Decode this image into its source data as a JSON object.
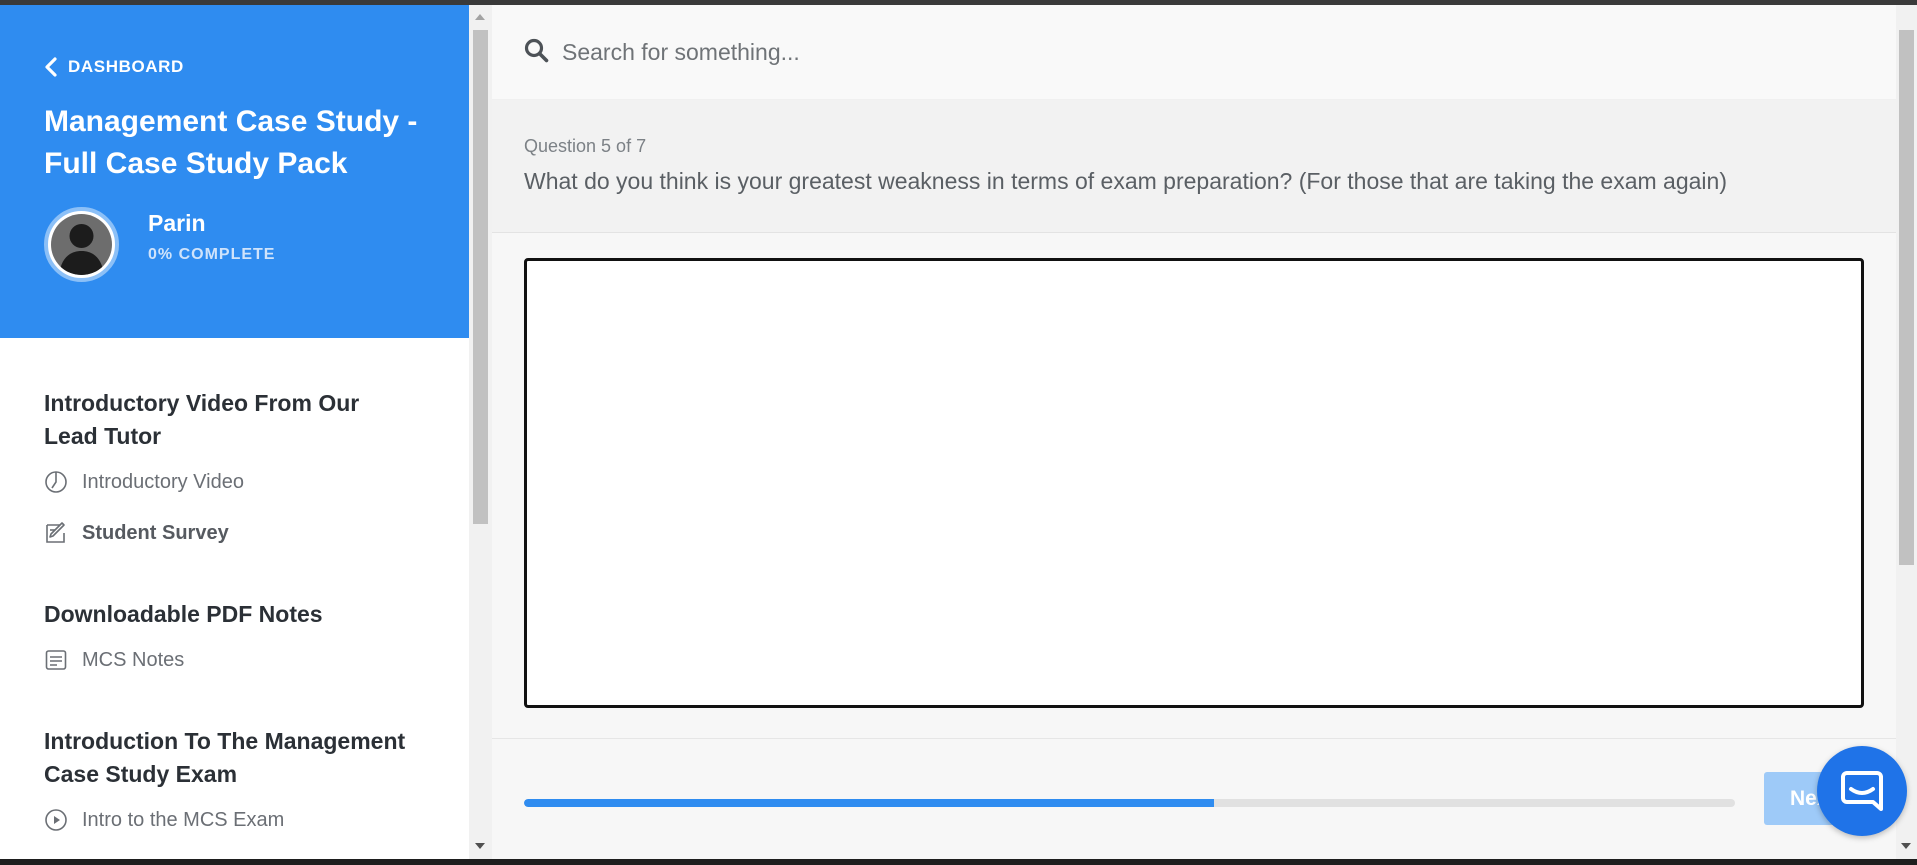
{
  "sidebar": {
    "back_label": "DASHBOARD",
    "course_title": "Management Case Study - Full Case Study Pack",
    "user": {
      "name": "Parin",
      "progress_label": "0% COMPLETE"
    },
    "sections": [
      {
        "title": "Introductory Video From Our Lead Tutor",
        "lessons": [
          {
            "label": "Introductory Video",
            "icon": "clock-icon"
          },
          {
            "label": "Student Survey",
            "icon": "survey-icon",
            "active": true
          }
        ]
      },
      {
        "title": "Downloadable PDF Notes",
        "lessons": [
          {
            "label": "MCS Notes",
            "icon": "document-icon"
          }
        ]
      },
      {
        "title": "Introduction To The Management Case Study Exam",
        "lessons": [
          {
            "label": "Intro to the MCS Exam",
            "icon": "play-icon"
          }
        ]
      }
    ]
  },
  "search": {
    "placeholder": "Search for something..."
  },
  "quiz": {
    "counter": "Question 5 of 7",
    "question": "What do you think is your greatest weakness in terms of exam preparation? (For those that are taking the exam again)",
    "answer": "",
    "progress_percent": 57,
    "next_label": "Next"
  },
  "colors": {
    "brand": "#2f8cf0",
    "chat": "#1f73e8",
    "next_button": "#9ecaf8"
  }
}
